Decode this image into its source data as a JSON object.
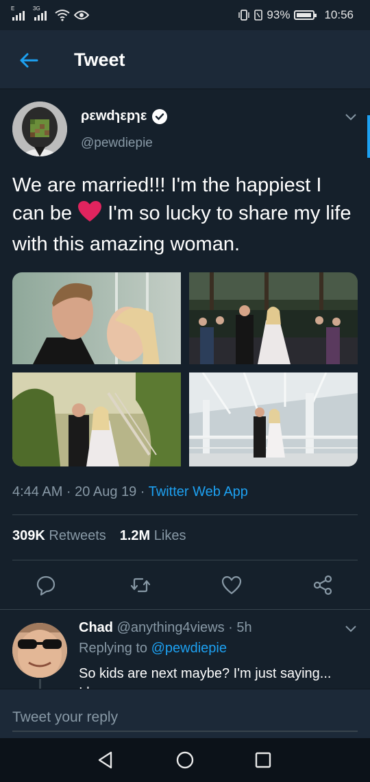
{
  "status_bar": {
    "sim_labels": [
      "E",
      "3G"
    ],
    "battery": "93%",
    "time": "10:56"
  },
  "header": {
    "title": "Tweet"
  },
  "tweet": {
    "author_name": "ρεwdɿεpɿε",
    "handle": "@pewdiepie",
    "text_before_emoji": "We are married!!! I'm the happiest I can be ",
    "text_after_emoji": " I'm so lucky to share my life with this amazing woman.",
    "time": "4:44 AM · 20 Aug 19 · ",
    "source": "Twitter Web App",
    "retweets_count": "309K",
    "retweets_label": "Retweets",
    "likes_count": "1.2M",
    "likes_label": "Likes"
  },
  "reply": {
    "name": "Chad",
    "handle_time": "@anything4views · 5h",
    "replying_label": "Replying to",
    "replying_to": "@pewdiepie",
    "text": "So kids are next maybe? I'm just saying...",
    "text_line2": "I hope"
  },
  "compose": {
    "placeholder": "Tweet your reply"
  },
  "colors": {
    "background": "#15202b",
    "header": "#1c2938",
    "accent": "#1da1f2",
    "secondary_text": "#8899a6",
    "heart": "#e0245e"
  }
}
